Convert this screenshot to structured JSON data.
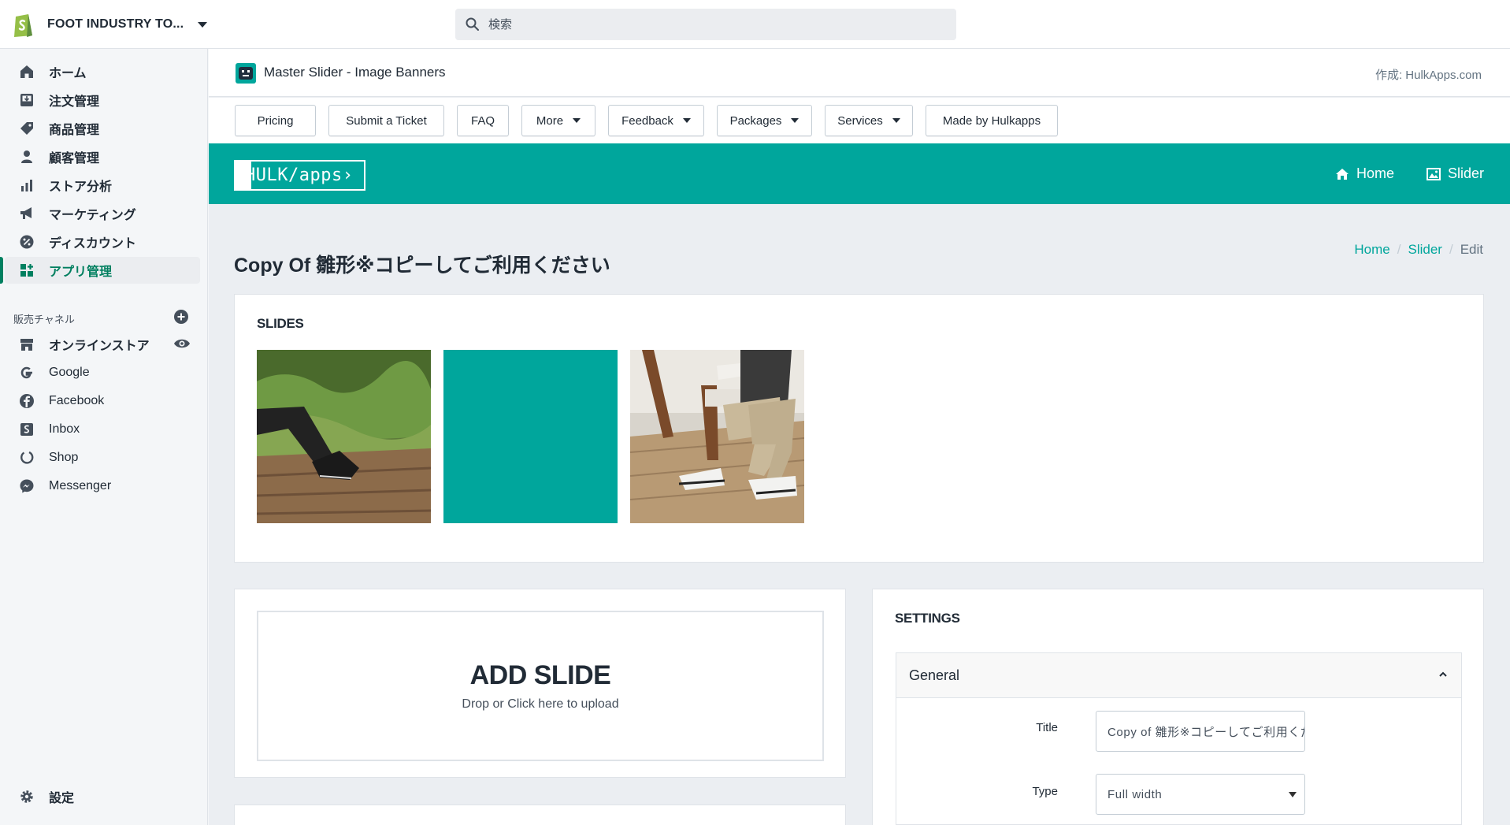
{
  "topbar": {
    "store_name": "FOOT INDUSTRY TO...",
    "search_placeholder": "検索",
    "colors": {
      "brand": "#95bf47"
    }
  },
  "sidebar": {
    "items": [
      {
        "label": "ホーム",
        "icon": "home-icon"
      },
      {
        "label": "注文管理",
        "icon": "orders-icon"
      },
      {
        "label": "商品管理",
        "icon": "tag-icon"
      },
      {
        "label": "顧客管理",
        "icon": "customer-icon"
      },
      {
        "label": "ストア分析",
        "icon": "analytics-icon"
      },
      {
        "label": "マーケティング",
        "icon": "megaphone-icon"
      },
      {
        "label": "ディスカウント",
        "icon": "discount-icon"
      },
      {
        "label": "アプリ管理",
        "icon": "apps-icon",
        "active": true
      }
    ],
    "channels_title": "販売チャネル",
    "channels": [
      {
        "label": "オンラインストア",
        "icon": "store-icon"
      },
      {
        "label": "Google",
        "icon": "google-icon"
      },
      {
        "label": "Facebook",
        "icon": "facebook-icon"
      },
      {
        "label": "Inbox",
        "icon": "inbox-icon"
      },
      {
        "label": "Shop",
        "icon": "shop-icon"
      },
      {
        "label": "Messenger",
        "icon": "messenger-icon"
      }
    ],
    "settings_label": "設定",
    "colors": {
      "active": "#008060"
    }
  },
  "app": {
    "title": "Master Slider - Image Banners",
    "author": "作成: HulkApps.com",
    "toolbar": [
      {
        "label": "Pricing",
        "dropdown": false
      },
      {
        "label": "Submit a Ticket",
        "dropdown": false
      },
      {
        "label": "FAQ",
        "dropdown": false
      },
      {
        "label": "More",
        "dropdown": true
      },
      {
        "label": "Feedback",
        "dropdown": true
      },
      {
        "label": "Packages",
        "dropdown": true
      },
      {
        "label": "Services",
        "dropdown": true
      },
      {
        "label": "Made by Hulkapps",
        "dropdown": false
      }
    ],
    "banner": {
      "logo_text": "HULK/apps›",
      "home_link": "Home",
      "slider_link": "Slider",
      "color": "#00a69c"
    },
    "page_title": "Copy Of 雛形※コピーしてご利用ください",
    "breadcrumb": {
      "home": "Home",
      "slider": "Slider",
      "current": "Edit"
    },
    "slides": {
      "title": "SLIDES",
      "items": [
        {
          "kind": "photo-legs-on-deck"
        },
        {
          "kind": "solid-teal",
          "color": "#00a69c"
        },
        {
          "kind": "photo-person-reading"
        }
      ]
    },
    "add_slide": {
      "title": "ADD SLIDE",
      "hint": "Drop or Click here to upload"
    },
    "settings": {
      "title": "SETTINGS",
      "section": "General",
      "title_label": "Title",
      "title_value": "Copy of 雛形※コピーしてご利用ください",
      "type_label": "Type",
      "type_value": "Full width"
    }
  }
}
